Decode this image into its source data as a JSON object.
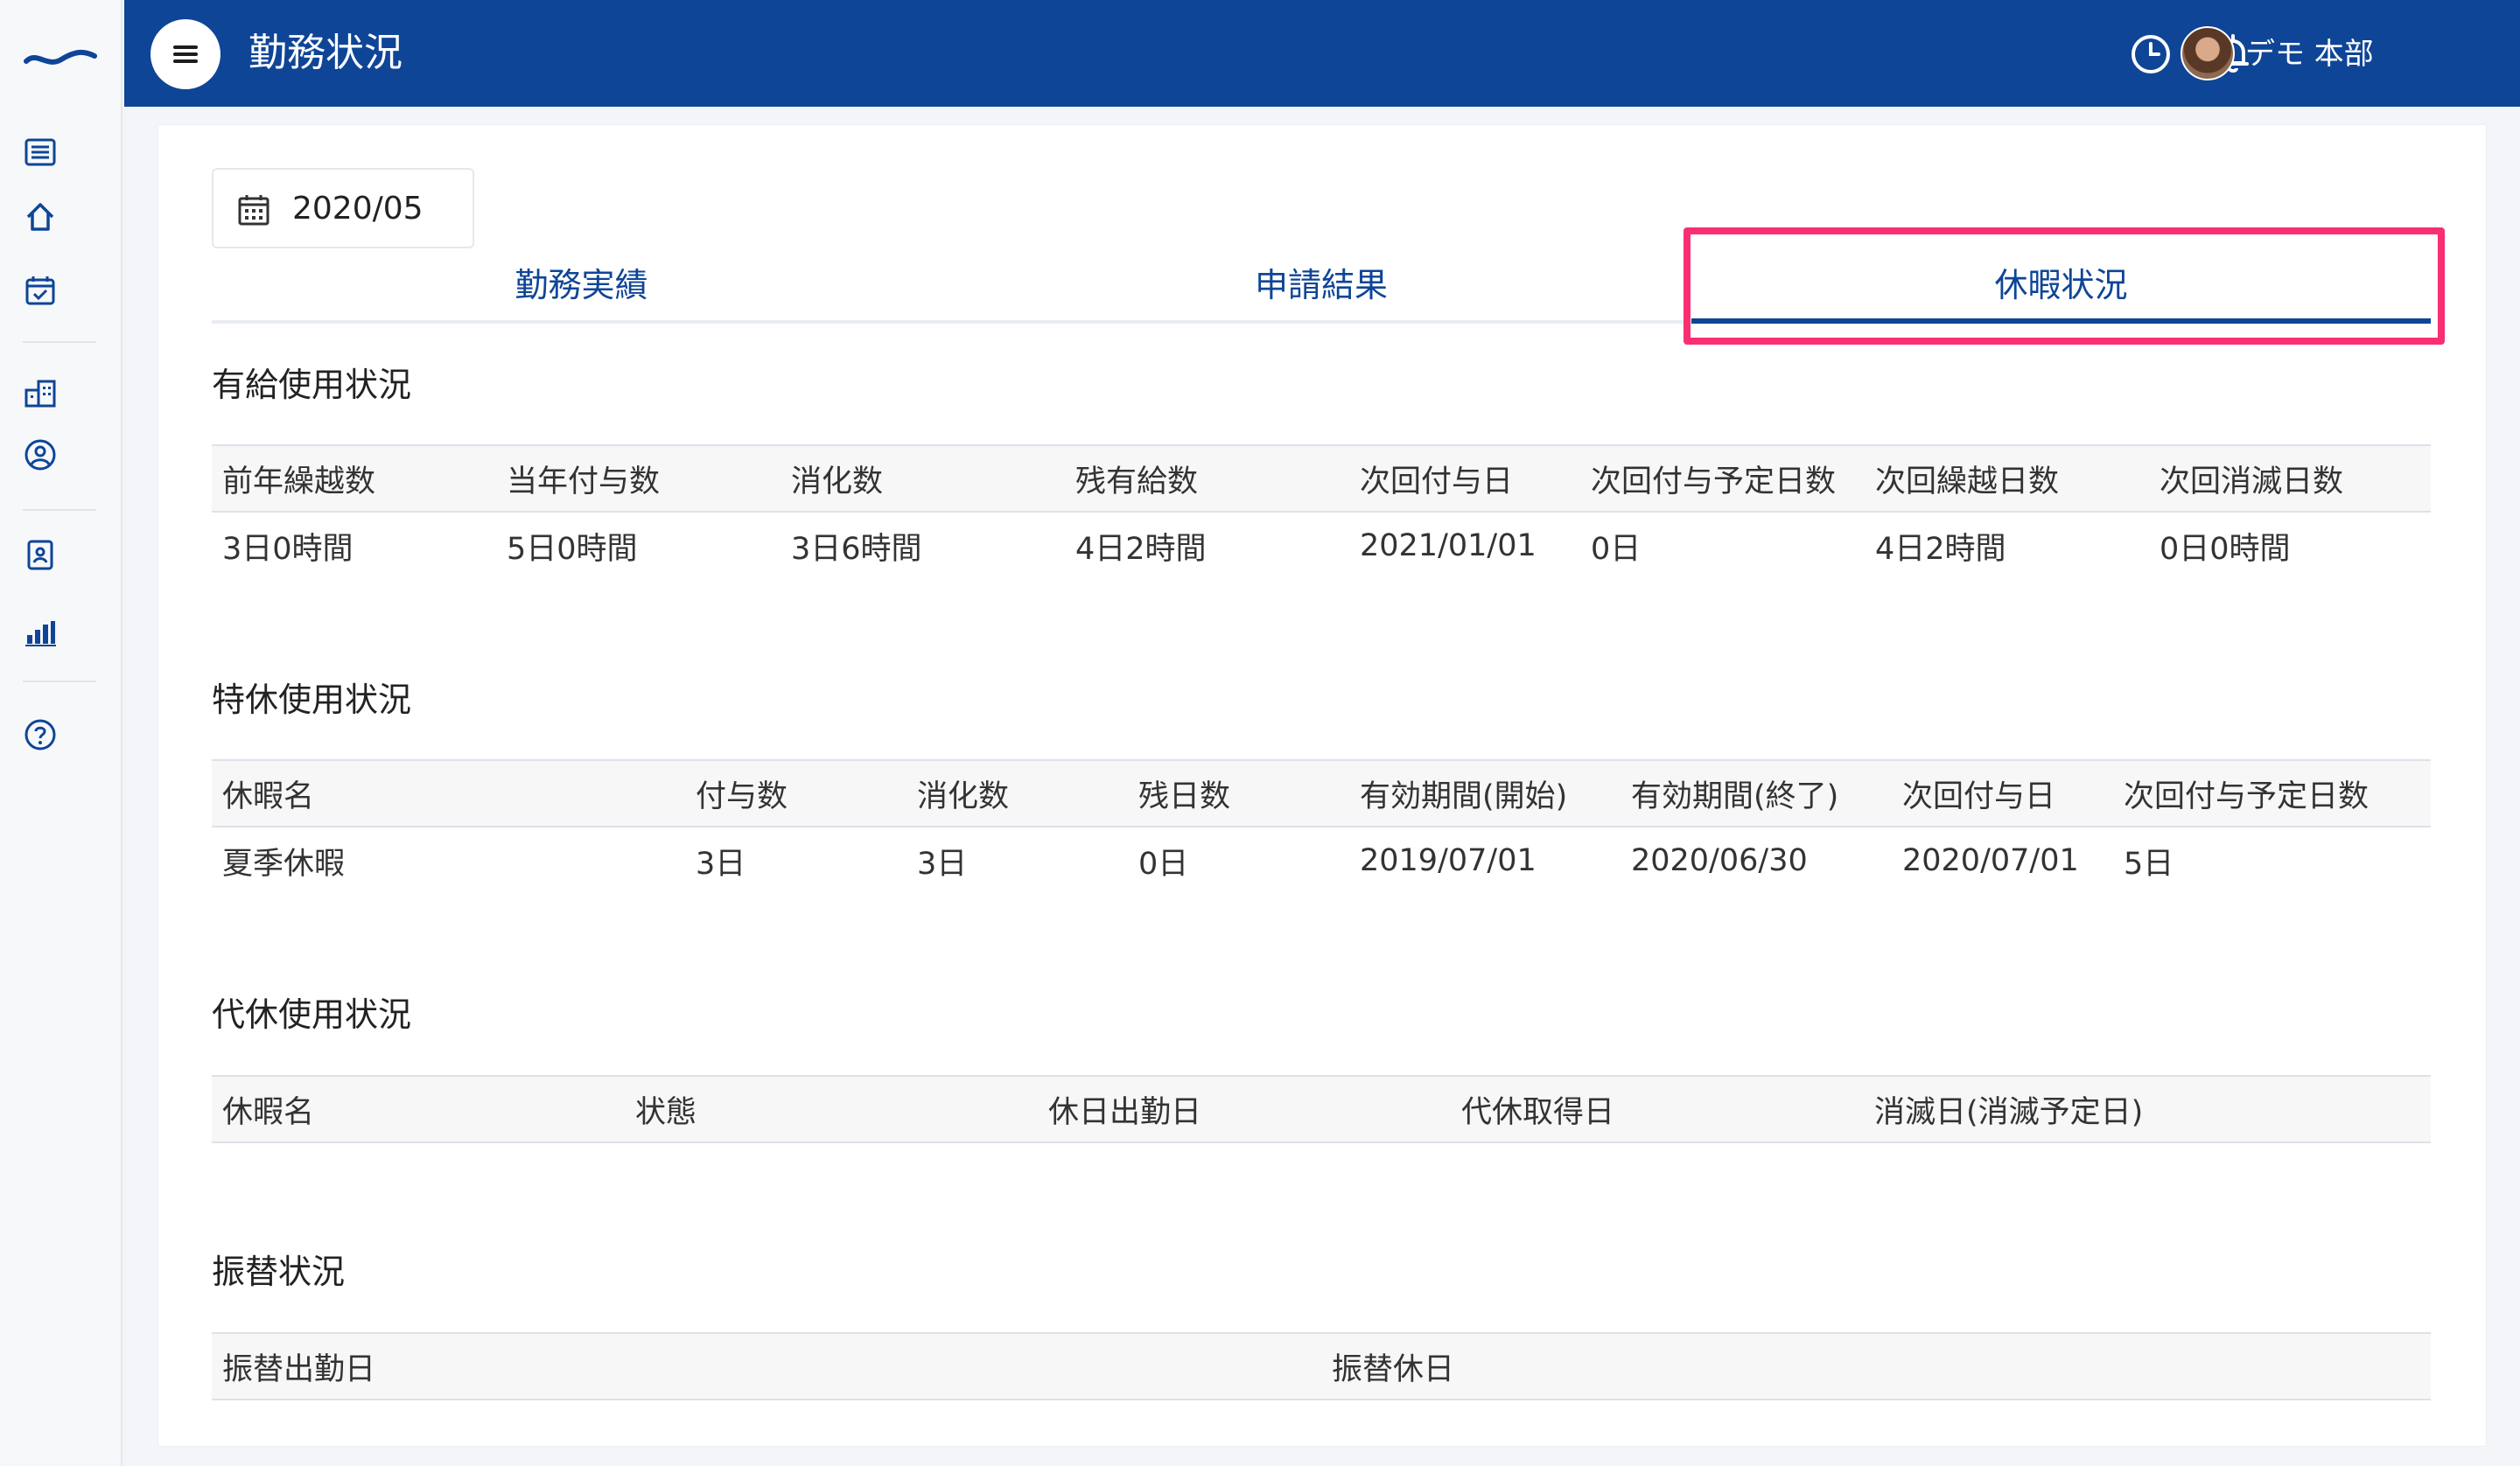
{
  "header": {
    "title": "勤務状況",
    "user_name": "デモ 本部"
  },
  "sidebar": {
    "icons": [
      "logo-wave-icon",
      "list-icon",
      "home-icon",
      "calendar-check-icon",
      "building-icon",
      "user-circle-icon",
      "id-badge-icon",
      "bar-chart-icon",
      "help-icon"
    ]
  },
  "month_picker": {
    "value": "2020/05"
  },
  "tabs": [
    {
      "label": "勤務実績",
      "active": false
    },
    {
      "label": "申請結果",
      "active": false
    },
    {
      "label": "休暇状況",
      "active": true
    }
  ],
  "paid_leave": {
    "title": "有給使用状況",
    "headers": [
      "前年繰越数",
      "当年付与数",
      "消化数",
      "残有給数",
      "次回付与日",
      "次回付与予定日数",
      "次回繰越日数",
      "次回消滅日数"
    ],
    "row": [
      "3日0時間",
      "5日0時間",
      "3日6時間",
      "4日2時間",
      "2021/01/01",
      "0日",
      "4日2時間",
      "0日0時間"
    ]
  },
  "special_leave": {
    "title": "特休使用状況",
    "headers": [
      "休暇名",
      "付与数",
      "消化数",
      "残日数",
      "有効期間(開始)",
      "有効期間(終了)",
      "次回付与日",
      "次回付与予定日数"
    ],
    "row": [
      "夏季休暇",
      "3日",
      "3日",
      "0日",
      "2019/07/01",
      "2020/06/30",
      "2020/07/01",
      "5日"
    ]
  },
  "comp_leave": {
    "title": "代休使用状況",
    "headers": [
      "休暇名",
      "状態",
      "休日出勤日",
      "代休取得日",
      "消滅日(消滅予定日)"
    ]
  },
  "transfer": {
    "title": "振替状況",
    "headers": [
      "振替出勤日",
      "振替休日"
    ]
  },
  "colors": {
    "brand": "#0e4597",
    "highlight": "#fa2f72"
  }
}
